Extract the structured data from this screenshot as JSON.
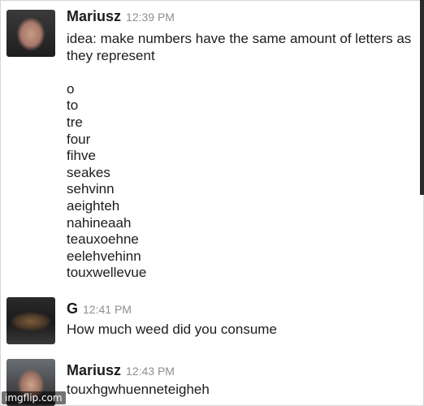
{
  "messages": [
    {
      "author": "Mariusz",
      "time": "12:39 PM",
      "avatar": "man-face-avatar",
      "text_lines": [
        "idea: make numbers have the same amount of letters as",
        "they represent",
        "",
        "o",
        "to",
        "tre",
        "four",
        "fihve",
        "seakes",
        "sehvinn",
        "aeighteh",
        "nahineaah",
        "teauxoehne",
        "eelehvehinn",
        "touxwellevue"
      ]
    },
    {
      "author": "G",
      "time": "12:41 PM",
      "avatar": "car-avatar",
      "text_lines": [
        "How much weed did you consume"
      ]
    },
    {
      "author": "Mariusz",
      "time": "12:43 PM",
      "avatar": "man-face-avatar",
      "text_lines": [
        "touxhgwhuenneteigheh"
      ]
    }
  ],
  "watermark": "imgflip.com"
}
